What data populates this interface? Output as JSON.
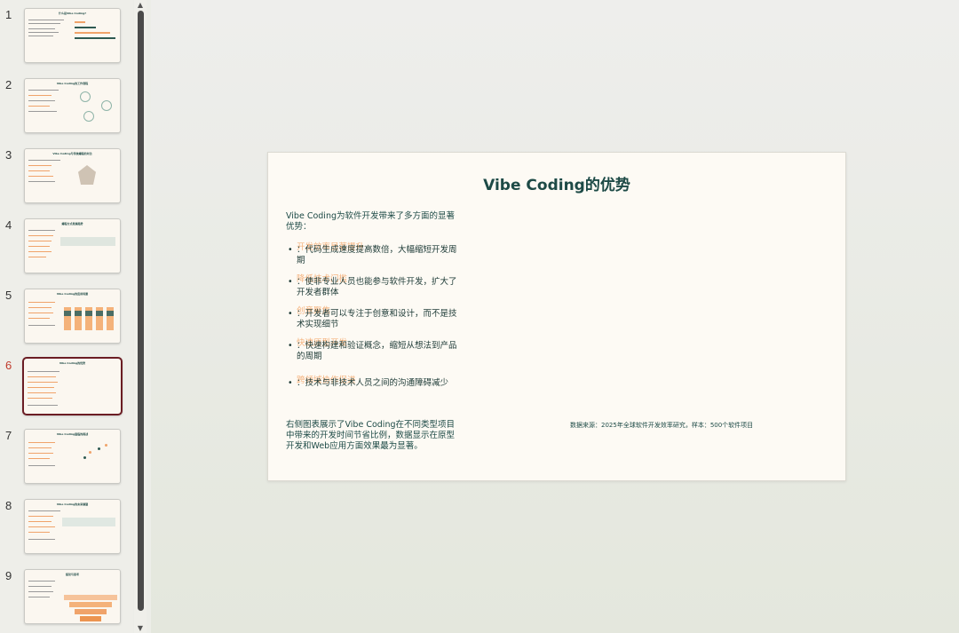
{
  "thumbnails": [
    {
      "num": "1",
      "title": "什么是Vibe Coding?"
    },
    {
      "num": "2",
      "title": "Vibe Coding的工作流程"
    },
    {
      "num": "3",
      "title": "Vibe Coding与传统编程的对比"
    },
    {
      "num": "4",
      "title": "编程方式发展趋势"
    },
    {
      "num": "5",
      "title": "Vibe Coding的应用场景"
    },
    {
      "num": "6",
      "title": "Vibe Coding的优势"
    },
    {
      "num": "7",
      "title": "Vibe Coding面临的挑战"
    },
    {
      "num": "8",
      "title": "Vibe Coding的未来展望"
    },
    {
      "num": "9",
      "title": "结论与思考"
    }
  ],
  "slide": {
    "title": "Vibe Coding的优势",
    "intro": "Vibe Coding为软件开发带来了多方面的显著优势：",
    "bullets": [
      {
        "heading": "开发效率显著提升",
        "text": "：代码生成速度提高数倍，大幅缩短开发周期"
      },
      {
        "heading": "降低技术门槛",
        "text": "：使非专业人员也能参与软件开发，扩大了开发者群体"
      },
      {
        "heading": "创意聚焦",
        "text": "：开发者可以专注于创意和设计，而不是技术实现细节"
      },
      {
        "heading": "快速原型开发",
        "text": "：快速构建和验证概念，缩短从想法到产品的周期"
      },
      {
        "heading": "跨领域协作促进",
        "text": "：技术与非技术人员之间的沟通障碍减少"
      }
    ],
    "summary": "右侧图表展示了Vibe Coding在不同类型项目中带来的开发时间节省比例，数据显示在原型开发和Web应用方面效果最为显著。",
    "source": "数据来源：2025年全球软件开发效率研究，样本：500个软件项目"
  },
  "active_slide": 6
}
